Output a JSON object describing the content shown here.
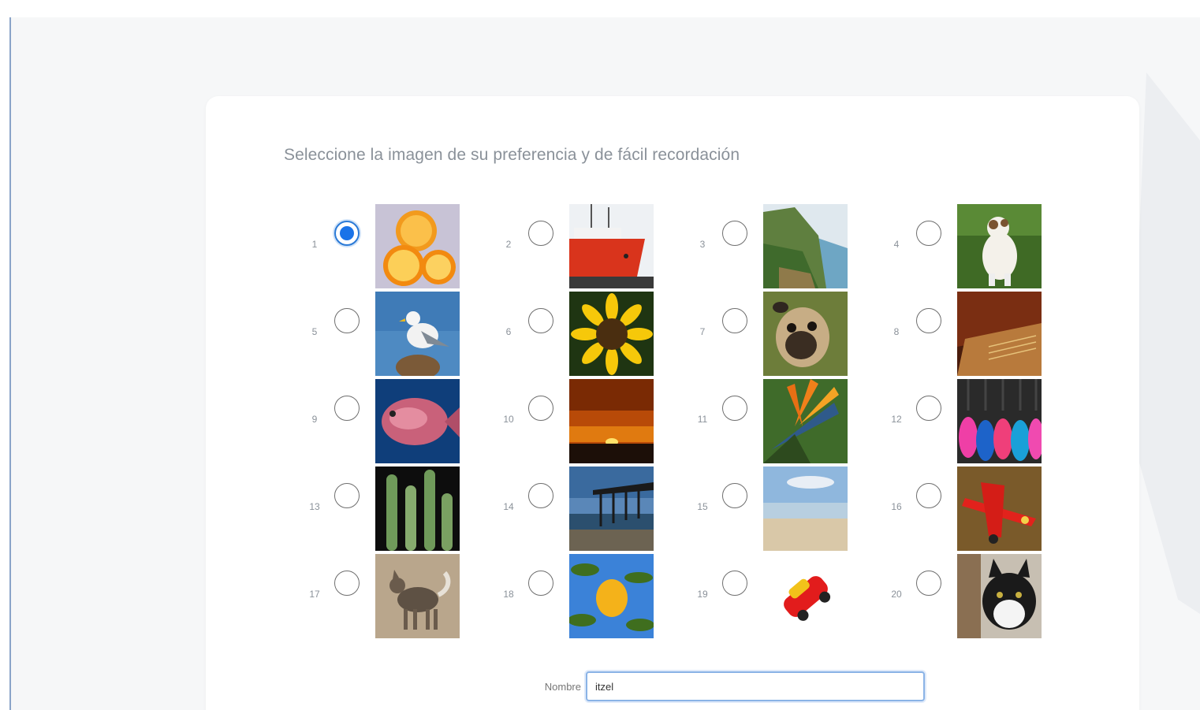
{
  "page": {
    "title": "Seleccione la imagen de su preferencia y de fácil recordación"
  },
  "options": [
    {
      "number": "1",
      "image": "oranges",
      "selected": true
    },
    {
      "number": "2",
      "image": "red-boat",
      "selected": false
    },
    {
      "number": "3",
      "image": "coastal-cliff",
      "selected": false
    },
    {
      "number": "4",
      "image": "jack-russell-dog",
      "selected": false
    },
    {
      "number": "5",
      "image": "seagull",
      "selected": false
    },
    {
      "number": "6",
      "image": "sunflower",
      "selected": false
    },
    {
      "number": "7",
      "image": "pug",
      "selected": false
    },
    {
      "number": "8",
      "image": "piano",
      "selected": false
    },
    {
      "number": "9",
      "image": "fish",
      "selected": false
    },
    {
      "number": "10",
      "image": "sunset",
      "selected": false
    },
    {
      "number": "11",
      "image": "bird-of-paradise-flower",
      "selected": false
    },
    {
      "number": "12",
      "image": "guitars",
      "selected": false
    },
    {
      "number": "13",
      "image": "cactus",
      "selected": false
    },
    {
      "number": "14",
      "image": "pier",
      "selected": false
    },
    {
      "number": "15",
      "image": "beach",
      "selected": false
    },
    {
      "number": "16",
      "image": "red-airplane",
      "selected": false
    },
    {
      "number": "17",
      "image": "husky",
      "selected": false
    },
    {
      "number": "18",
      "image": "lemon-tree",
      "selected": false
    },
    {
      "number": "19",
      "image": "toy-car",
      "selected": false
    },
    {
      "number": "20",
      "image": "cat",
      "selected": false
    }
  ],
  "form": {
    "name_label": "Nombre",
    "name_value": "itzel"
  }
}
